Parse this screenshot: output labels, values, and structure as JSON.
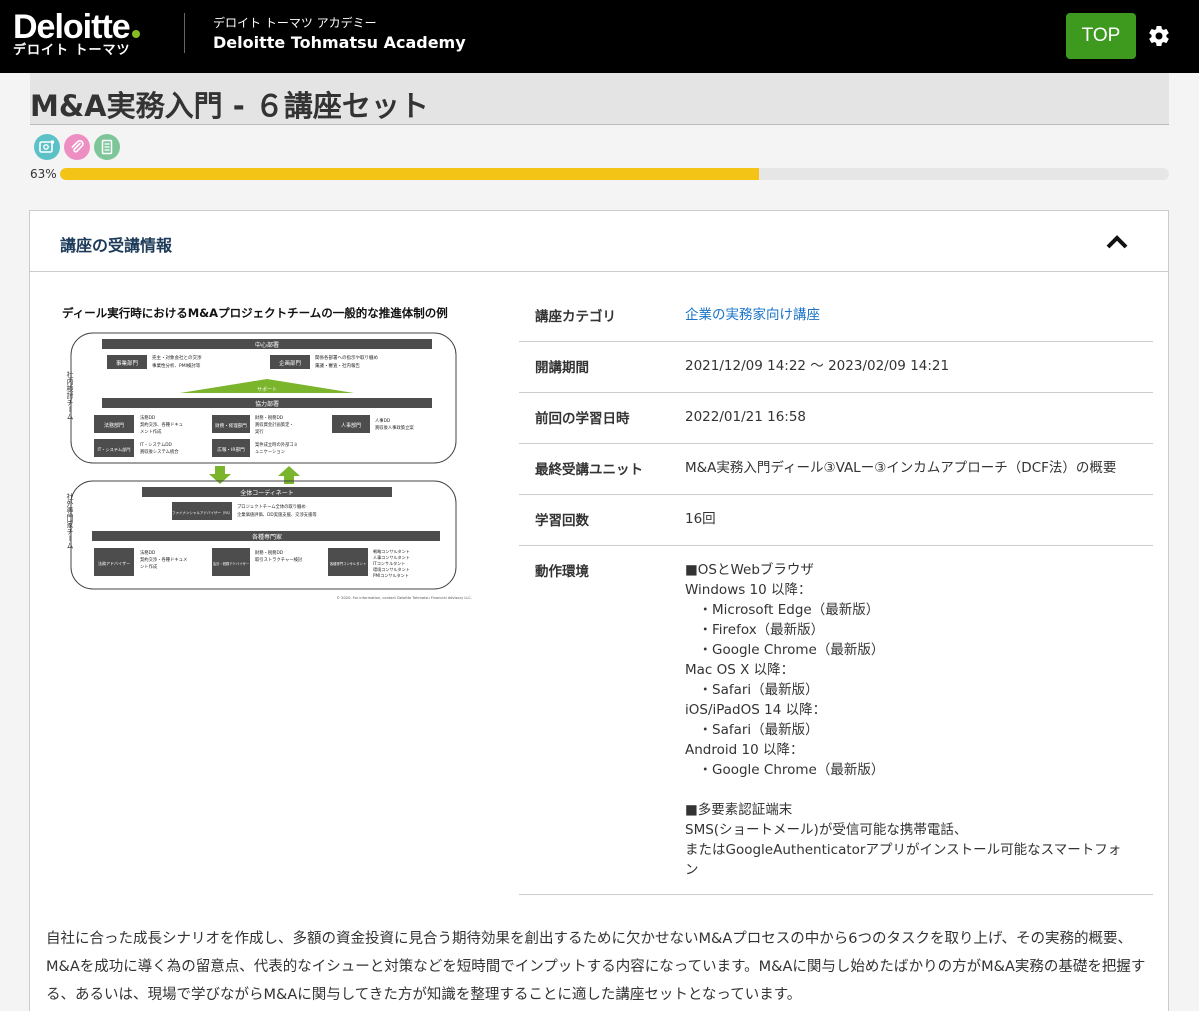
{
  "header": {
    "logo_word": "Deloitte",
    "logo_sub": "デロイト トーマツ",
    "academy_jp": "デロイト トーマツ アカデミー",
    "academy_en": "Deloitte Tohmatsu Academy",
    "top_button": "TOP",
    "brand_green": "#86bc25",
    "button_green": "#3d9a1e"
  },
  "course": {
    "title": "M&A実務入門 - ６講座セット",
    "material_icons": [
      "video-icon",
      "attachment-icon",
      "document-icon"
    ],
    "progress_label": "63%",
    "progress_value": 0.63,
    "progress_color": "#f3c315"
  },
  "panel": {
    "title": "講座の受講情報"
  },
  "diagram": {
    "title": "ディール実行時におけるM&Aプロジェクトチームの一般的な推進体制の例",
    "side_top": "社内検討チーム",
    "side_bottom": "社外専門家チーム",
    "core_header": "中心部署",
    "core_left_box": "事業部門",
    "core_left_notes": [
      "売主・対象会社との交渉",
      "事業性分析、PMI検討等"
    ],
    "core_right_box": "企画部門",
    "core_right_notes": [
      "関係各部署への指示や取り纏め",
      "稟議・審査・社内報告"
    ],
    "support_label": "サポート",
    "coop_header": "協力部署",
    "coop_boxes": [
      {
        "box": "法務部門",
        "notes": [
          "法務DD",
          "契約交渉、各種ドキュ",
          "メント作成"
        ]
      },
      {
        "box": "財務・経理部門",
        "notes": [
          "財務・税務DD",
          "買収資金計画策定・",
          "実行"
        ]
      },
      {
        "box": "人事部門",
        "notes": [
          "人事DD",
          "買収後人事政策立案"
        ]
      },
      {
        "box": "IT・システム部門",
        "notes": [
          "IT・システムDD",
          "買収後システム統合"
        ]
      },
      {
        "box": "広報・IR部門",
        "notes": [
          "案件成立時の外部コミ",
          "ュニケーション"
        ]
      }
    ],
    "coord_header": "全体コーディネート",
    "coord_box": "ファイナンシャルアドバイザー（FA）",
    "coord_notes": [
      "プロジェクトチーム全体の取り纏め",
      "企業価値評価、DD実施支援、交渉支援等"
    ],
    "experts_header": "各種専門家",
    "expert_boxes": [
      {
        "box": "法務アドバイザー",
        "notes": [
          "法務DD",
          "契約交渉・各種ドキュメ",
          "ント作成"
        ]
      },
      {
        "box": "会計・税務アドバイザー",
        "notes": [
          "財務・税務DD",
          "取引ストラクチャー検討"
        ]
      },
      {
        "box": "各種専門コンサルタント",
        "notes": [
          "戦略コンサルタント",
          "人事コンサルタント",
          "ITコンサルタント",
          "環境コンサルタント",
          "PMIコンサルタント"
        ]
      }
    ],
    "copyright": "© 2020. For information, contact Deloitte Tohmatsu Financial Advisory LLC."
  },
  "info": [
    {
      "label": "講座カテゴリ",
      "value": "企業の実務家向け講座",
      "link": true
    },
    {
      "label": "開講期間",
      "value": "2021/12/09 14:22 〜 2023/02/09 14:21"
    },
    {
      "label": "前回の学習日時",
      "value": "2022/01/21 16:58"
    },
    {
      "label": "最終受講ユニット",
      "value": "M&A実務入門ディール③VALー③インカムアプローチ（DCF法）の概要"
    },
    {
      "label": "学習回数",
      "value": "16回"
    }
  ],
  "environment": {
    "label": "動作環境",
    "lines": [
      "■OSとWebブラウザ",
      "Windows 10 以降：",
      "　・Microsoft Edge（最新版）",
      "　・Firefox（最新版）",
      "　・Google Chrome（最新版）",
      "Mac OS X 以降：",
      "　・Safari（最新版）",
      "iOS/iPadOS 14 以降：",
      "　・Safari（最新版）",
      "Android 10 以降：",
      "　・Google Chrome（最新版）",
      "",
      "■多要素認証端末",
      "SMS(ショートメール)が受信可能な携帯電話、",
      "またはGoogleAuthenticatorアプリがインストール可能なスマートフォ",
      "ン"
    ]
  },
  "description": "自社に合った成長シナリオを作成し、多額の資金投資に見合う期待効果を創出するために欠かせないM&Aプロセスの中から6つのタスクを取り上げ、その実務的概要、M&Aを成功に導く為の留意点、代表的なイシューと対策などを短時間でインプットする内容になっています。M&Aに関与し始めたばかりの方がM&A実務の基礎を把握する、あるいは、現場で学びながらM&Aに関与してきた方が知識を整理することに適した講座セットとなっています。"
}
